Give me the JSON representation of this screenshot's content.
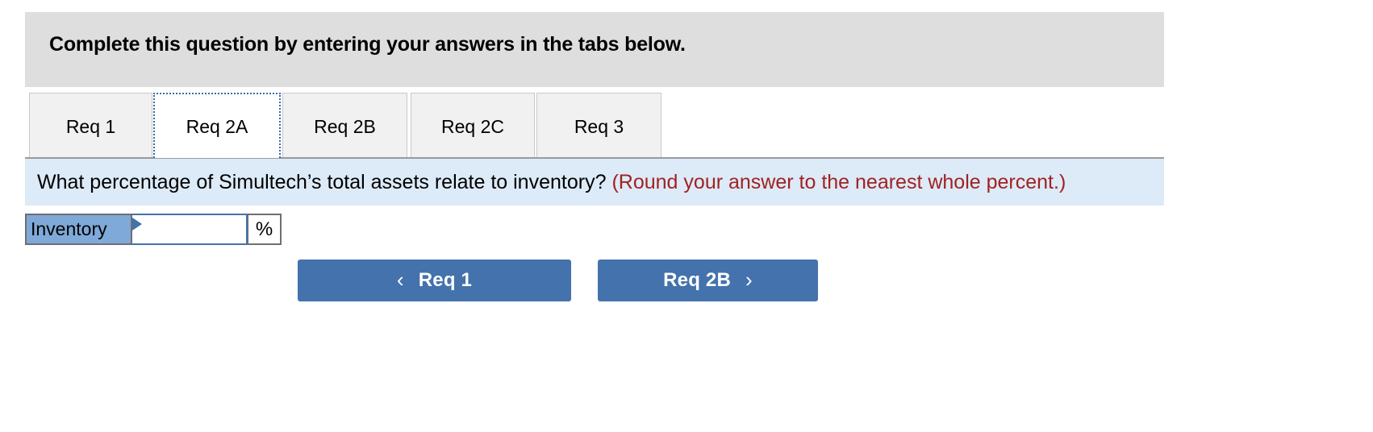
{
  "header": {
    "instruction": "Complete this question by entering your answers in the tabs below."
  },
  "tabs": {
    "active_index": 1,
    "items": [
      {
        "label": "Req 1"
      },
      {
        "label": "Req 2A"
      },
      {
        "label": "Req 2B"
      },
      {
        "label": "Req 2C"
      },
      {
        "label": "Req 3"
      }
    ]
  },
  "question": {
    "text": "What percentage of Simultech’s total assets relate to inventory?",
    "note": "(Round your answer to the nearest whole percent.)"
  },
  "answer_row": {
    "row_label": "Inventory",
    "input_value": "",
    "input_placeholder": "",
    "unit": "%"
  },
  "navigation": {
    "prev_label": "Req 1",
    "prev_icon": "chevron-left-icon",
    "prev_glyph": "‹",
    "next_label": "Req 2B",
    "next_icon": "chevron-right-icon",
    "next_glyph": "›"
  },
  "colors": {
    "header_bg": "#dedede",
    "question_bg": "#ddeaf7",
    "note_text": "#a02222",
    "button_blue": "#4472ac",
    "label_cell_blue": "#7fa9d8",
    "tab_inactive_bg": "#f1f1f1",
    "tab_active_border": "#3b6aa8"
  }
}
